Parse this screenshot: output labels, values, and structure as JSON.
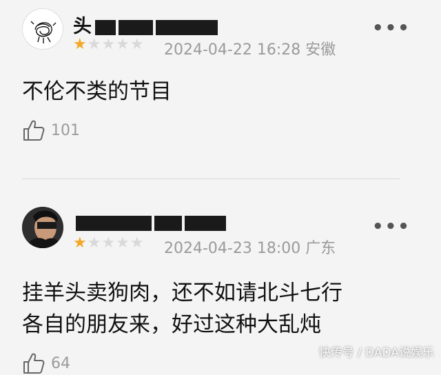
{
  "comments": [
    {
      "username": "头",
      "rating": 1,
      "rating_max": 5,
      "date": "2024-04-22 16:28",
      "location": "安徽",
      "text": "不伦不类的节目",
      "likes": "101"
    },
    {
      "username": "",
      "rating": 1,
      "rating_max": 5,
      "date": "2024-04-23 18:00",
      "location": "广东",
      "text_line1": "挂羊头卖狗肉，还不如请北斗七行",
      "text_line2": "各自的朋友来，好过这种大乱炖",
      "likes": "64"
    }
  ],
  "more_label": "•••",
  "watermark": "快传号 / DADA说娱乐",
  "colors": {
    "star_on": "#f5a623",
    "star_off": "#d9d9d9",
    "meta": "#9a9a9a",
    "background": "#f3f4f3"
  }
}
